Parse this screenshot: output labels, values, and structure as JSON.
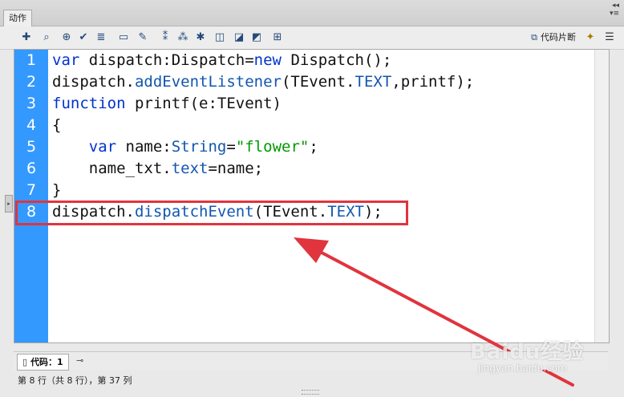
{
  "panel": {
    "tab_label": "动作",
    "collapse_glyph": "◂◂",
    "menu_glyph": "▾≡"
  },
  "toolbar": {
    "icons": [
      "add-icon",
      "find-icon",
      "target-icon",
      "check-syntax-icon",
      "auto-format-icon",
      "code-hint-icon",
      "debug-icon",
      "collapse-icon",
      "expand-icon",
      "collapse-selection-icon",
      "comment-block-icon",
      "comment-line-icon",
      "uncomment-icon",
      "script-assist-icon"
    ],
    "snippets_label": "代码片断"
  },
  "editor": {
    "lines": [
      {
        "num": "1",
        "segments": [
          {
            "t": "var",
            "c": "kw"
          },
          {
            "t": " dispatch:Dispatch=",
            "c": ""
          },
          {
            "t": "new",
            "c": "kw"
          },
          {
            "t": " Dispatch();",
            "c": ""
          }
        ]
      },
      {
        "num": "2",
        "segments": [
          {
            "t": "dispatch.",
            "c": ""
          },
          {
            "t": "addEventListener",
            "c": "prop"
          },
          {
            "t": "(TEvent.",
            "c": ""
          },
          {
            "t": "TEXT",
            "c": "prop"
          },
          {
            "t": ",printf);",
            "c": ""
          }
        ]
      },
      {
        "num": "3",
        "segments": [
          {
            "t": "function",
            "c": "kw"
          },
          {
            "t": " printf(e:TEvent)",
            "c": ""
          }
        ]
      },
      {
        "num": "4",
        "segments": [
          {
            "t": "{",
            "c": ""
          }
        ]
      },
      {
        "num": "5",
        "segments": [
          {
            "t": "    ",
            "c": ""
          },
          {
            "t": "var",
            "c": "kw"
          },
          {
            "t": " name:",
            "c": ""
          },
          {
            "t": "String",
            "c": "prop"
          },
          {
            "t": "=",
            "c": ""
          },
          {
            "t": "\"flower\"",
            "c": "str"
          },
          {
            "t": ";",
            "c": ""
          }
        ]
      },
      {
        "num": "6",
        "segments": [
          {
            "t": "    name_txt.",
            "c": ""
          },
          {
            "t": "text",
            "c": "prop"
          },
          {
            "t": "=name;",
            "c": ""
          }
        ]
      },
      {
        "num": "7",
        "segments": [
          {
            "t": "}",
            "c": ""
          }
        ]
      },
      {
        "num": "8",
        "segments": [
          {
            "t": "dispatch.",
            "c": ""
          },
          {
            "t": "dispatchEvent",
            "c": "prop"
          },
          {
            "t": "(TEvent.",
            "c": ""
          },
          {
            "t": "TEXT",
            "c": "prop"
          },
          {
            "t": ");",
            "c": ""
          }
        ]
      }
    ]
  },
  "bottom": {
    "code_tab_label": "代码：1"
  },
  "status": {
    "text": "第 8 行（共 8 行），第 37 列"
  },
  "watermark": {
    "logo": "Baidu经验",
    "url": "jingyan.baidu.com"
  },
  "colors": {
    "gutter": "#3399ff",
    "keyword": "#0033cc",
    "string": "#009900",
    "highlight": "#e0343e"
  }
}
